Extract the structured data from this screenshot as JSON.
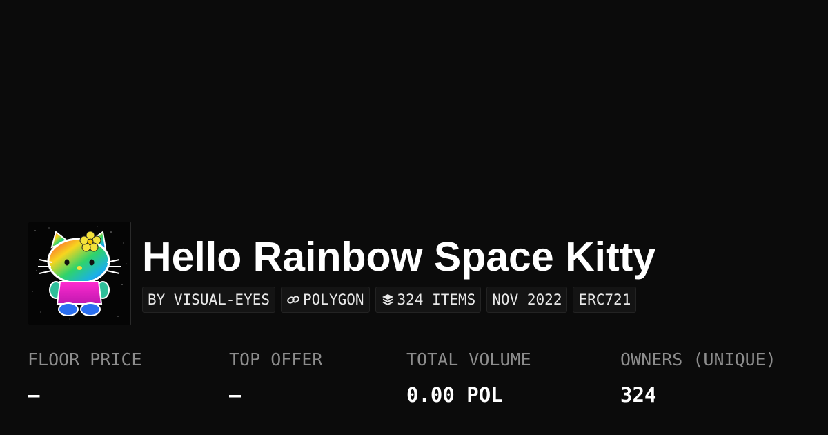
{
  "collection": {
    "title": "Hello Rainbow Space Kitty",
    "avatar_icon": "rainbow-kitty-artwork"
  },
  "chips": {
    "creator": "BY VISUAL-EYES",
    "chain": "POLYGON",
    "chain_icon": "link-icon",
    "items": "324 ITEMS",
    "items_icon": "layers-icon",
    "date": "NOV 2022",
    "standard": "ERC721"
  },
  "stats": {
    "floor_price": {
      "label": "FLOOR PRICE",
      "value": "–"
    },
    "top_offer": {
      "label": "TOP OFFER",
      "value": "–"
    },
    "total_volume": {
      "label": "TOTAL VOLUME",
      "value": "0.00 POL"
    },
    "owners": {
      "label": "OWNERS (UNIQUE)",
      "value": "324"
    }
  },
  "colors": {
    "background": "#0b0b0b",
    "chip_background": "#141414",
    "label_gray": "#8d8d8d"
  }
}
